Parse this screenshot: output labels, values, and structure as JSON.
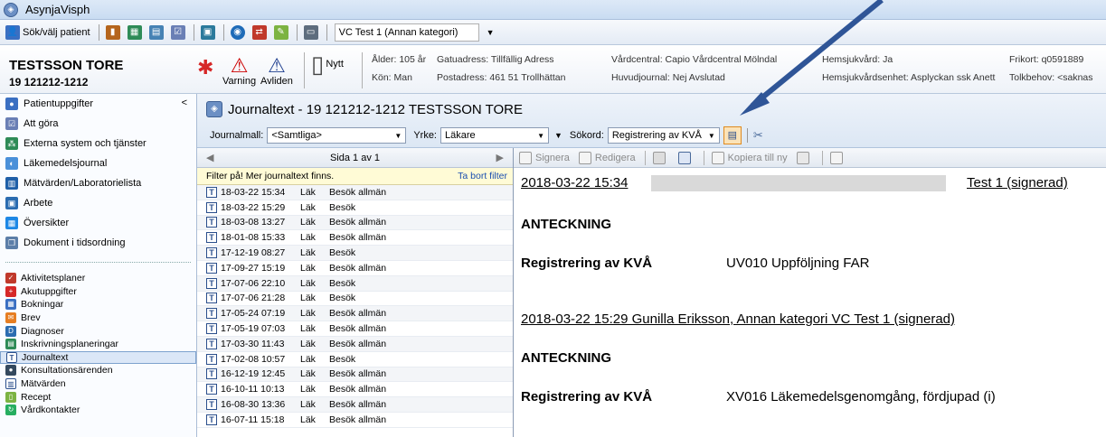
{
  "window": {
    "title": "AsynjaVisph"
  },
  "toolbar": {
    "search_patient": "Sök/välj patient",
    "unit_select": "VC Test 1 (Annan kategori)"
  },
  "patient": {
    "name": "TESTSSON TORE",
    "id": "19 121212-1212",
    "warning_label": "Varning",
    "deceased_label": "Avliden",
    "new_label": "Nytt",
    "info": {
      "age": "Ålder: 105 år",
      "gender": "Kön: Man",
      "street": "Gatuadress: Tillfällig Adress",
      "postal": "Postadress: 461 51 Trollhättan",
      "care_center": "Vårdcentral: Capio Vårdcentral Mölndal",
      "main_journal": "Huvudjournal: Nej Avslutad",
      "home_care": "Hemsjukvård: Ja",
      "home_care_unit": "Hemsjukvårdsenhet: Asplyckan ssk Anett",
      "free_card": "Frikort: q0591889",
      "interpreter": "Tolkbehov: <saknas"
    }
  },
  "sidebar": {
    "top_items": [
      {
        "label": "Patientuppgifter",
        "icon": "person-icon"
      },
      {
        "label": "Att göra",
        "icon": "checkbox-icon"
      },
      {
        "label": "Externa system och tjänster",
        "icon": "network-icon"
      },
      {
        "label": "Läkemedelsjournal",
        "icon": "pill-icon"
      },
      {
        "label": "Mätvärden/Laboratorielista",
        "icon": "chart-icon"
      },
      {
        "label": "Arbete",
        "icon": "work-icon"
      },
      {
        "label": "Översikter",
        "icon": "grid-icon"
      },
      {
        "label": "Dokument i tidsordning",
        "icon": "documents-icon"
      }
    ],
    "bottom_items": [
      {
        "label": "Aktivitetsplaner",
        "icon": "checklist-icon"
      },
      {
        "label": "Akutuppgifter",
        "icon": "emergency-icon"
      },
      {
        "label": "Bokningar",
        "icon": "calendar-icon"
      },
      {
        "label": "Brev",
        "icon": "letter-icon"
      },
      {
        "label": "Diagnoser",
        "icon": "diagnosis-icon"
      },
      {
        "label": "Inskrivningsplaneringar",
        "icon": "admission-icon"
      },
      {
        "label": "Journaltext",
        "icon": "journal-icon"
      },
      {
        "label": "Konsultationsärenden",
        "icon": "consult-icon"
      },
      {
        "label": "Mätvärden",
        "icon": "measure-icon"
      },
      {
        "label": "Recept",
        "icon": "prescription-icon"
      },
      {
        "label": "Vårdkontakter",
        "icon": "contact-icon"
      }
    ]
  },
  "journal": {
    "title": "Journaltext  -  19 121212-1212 TESTSSON TORE",
    "template_label": "Journalmall:",
    "template_value": "<Samtliga>",
    "profession_label": "Yrke:",
    "profession_value": "Läkare",
    "search_label": "Sökord:",
    "search_value": "Registrering av KVÅ",
    "pager": "Sida 1 av 1",
    "filter_text": "Filter på! Mer journaltext finns.",
    "remove_filter": "Ta bort filter",
    "rows": [
      {
        "date": "18-03-22 15:34",
        "prof": "Läk",
        "type": "Besök allmän"
      },
      {
        "date": "18-03-22 15:29",
        "prof": "Läk",
        "type": "Besök"
      },
      {
        "date": "18-03-08 13:27",
        "prof": "Läk",
        "type": "Besök allmän"
      },
      {
        "date": "18-01-08 15:33",
        "prof": "Läk",
        "type": "Besök allmän"
      },
      {
        "date": "17-12-19 08:27",
        "prof": "Läk",
        "type": "Besök"
      },
      {
        "date": "17-09-27 15:19",
        "prof": "Läk",
        "type": "Besök allmän"
      },
      {
        "date": "17-07-06 22:10",
        "prof": "Läk",
        "type": "Besök"
      },
      {
        "date": "17-07-06 21:28",
        "prof": "Läk",
        "type": "Besök"
      },
      {
        "date": "17-05-24 07:19",
        "prof": "Läk",
        "type": "Besök allmän"
      },
      {
        "date": "17-05-19 07:03",
        "prof": "Läk",
        "type": "Besök allmän"
      },
      {
        "date": "17-03-30 11:43",
        "prof": "Läk",
        "type": "Besök allmän"
      },
      {
        "date": "17-02-08 10:57",
        "prof": "Läk",
        "type": "Besök"
      },
      {
        "date": "16-12-19 12:45",
        "prof": "Läk",
        "type": "Besök allmän"
      },
      {
        "date": "16-10-11 10:13",
        "prof": "Läk",
        "type": "Besök allmän"
      },
      {
        "date": "16-08-30 13:36",
        "prof": "Läk",
        "type": "Besök allmän"
      },
      {
        "date": "16-07-11 15:18",
        "prof": "Läk",
        "type": "Besök allmän"
      }
    ],
    "actions": {
      "sign": "Signera",
      "edit": "Redigera",
      "copy": "Kopiera till ny"
    },
    "notes": [
      {
        "header_date": "2018-03-22 15:34",
        "header_tail": "Test 1   (signerad)",
        "section": "ANTECKNING",
        "reg_label": "Registrering av KVÅ",
        "reg_value": "UV010 Uppföljning FAR"
      },
      {
        "header": "2018-03-22 15:29   Gunilla Eriksson, Annan kategori  VC Test 1   (signerad)",
        "section": "ANTECKNING",
        "reg_label": "Registrering av KVÅ",
        "reg_value": "XV016 Läkemedelsgenomgång, fördjupad (i)"
      }
    ]
  }
}
